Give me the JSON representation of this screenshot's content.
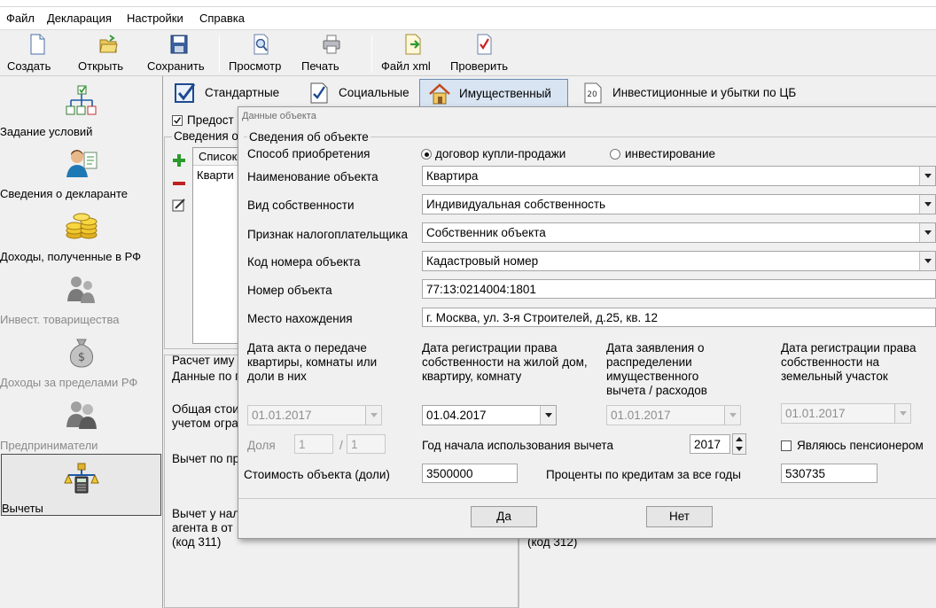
{
  "menu": [
    "Файл",
    "Декларация",
    "Настройки",
    "Справка"
  ],
  "toolbar": {
    "create": "Создать",
    "open": "Открыть",
    "save": "Сохранить",
    "preview": "Просмотр",
    "print": "Печать",
    "xml": "Файл xml",
    "check": "Проверить"
  },
  "sidebar": {
    "items": [
      {
        "label": "Задание условий"
      },
      {
        "label": "Сведения о декларанте"
      },
      {
        "label": "Доходы, полученные в РФ"
      },
      {
        "label": "Инвест. товарищества"
      },
      {
        "label": "Доходы за пределами РФ"
      },
      {
        "label": "Предприниматели"
      },
      {
        "label": "Вычеты"
      }
    ]
  },
  "tabs": {
    "standard": "Стандартные",
    "social": "Социальные",
    "property": "Имущественный",
    "invest": "Инвестиционные и убытки по ЦБ",
    "invest_icon_text": "20"
  },
  "background": {
    "checkbox_label": "Предост",
    "group_label": "Сведения о",
    "list_header": "Список",
    "list_row": "Кварти",
    "calc_header": "Расчет иму",
    "data_by": "Данные по п",
    "total_cost_1": "Общая стои",
    "total_cost_2": "учетом огра",
    "deduction": "Вычет по пр",
    "agent_1": "Вычет у нал",
    "agent_2": "агента в от",
    "agent_3": "(код 311)",
    "code_312": "(код 312)"
  },
  "dialog": {
    "title": "Данные объекта",
    "group": "Сведения об объекте",
    "acq_label": "Способ приобретения",
    "acq_opt1": "договор купли-продажи",
    "acq_opt2": "инвестирование",
    "name_label": "Наименование объекта",
    "name_value": "Квартира",
    "own_label": "Вид собственности",
    "own_value": "Индивидуальная собственность",
    "taxpayer_label": "Признак налогоплательщика",
    "taxpayer_value": "Собственник объекта",
    "code_label": "Код номера объекта",
    "code_value": "Кадастровый номер",
    "number_label": "Номер объекта",
    "number_value": "77:13:0214004:1801",
    "location_label": "Место нахождения",
    "location_value": "г. Москва, ул. 3-я Строителей, д.25, кв. 12",
    "d1_l1": "Дата акта о передаче",
    "d1_l2": "квартиры, комнаты или",
    "d1_l3": "доли в них",
    "d1_value": "01.01.2017",
    "d2_l1": "Дата регистрации права",
    "d2_l2": "собственности на жилой дом,",
    "d2_l3": "квартиру, комнату",
    "d2_value": "01.04.2017",
    "d3_l1": "Дата заявления о",
    "d3_l2": "распределении",
    "d3_l3": "имущественного",
    "d3_l4": "вычета / расходов",
    "d3_value": "01.01.2017",
    "d4_l1": "Дата регистрации права",
    "d4_l2": "собственности на",
    "d4_l3": "земельный участок",
    "d4_value": "01.01.2017",
    "share_label": "Доля",
    "share_num": "1",
    "share_slash": "/",
    "share_den": "1",
    "year_label": "Год начала использования вычета",
    "year_value": "2017",
    "pensioner_label": "Являюсь пенсионером",
    "cost_label": "Стоимость объекта (доли)",
    "cost_value": "3500000",
    "interest_label": "Проценты по кредитам за все годы",
    "interest_value": "530735",
    "yes": "Да",
    "no": "Нет"
  }
}
